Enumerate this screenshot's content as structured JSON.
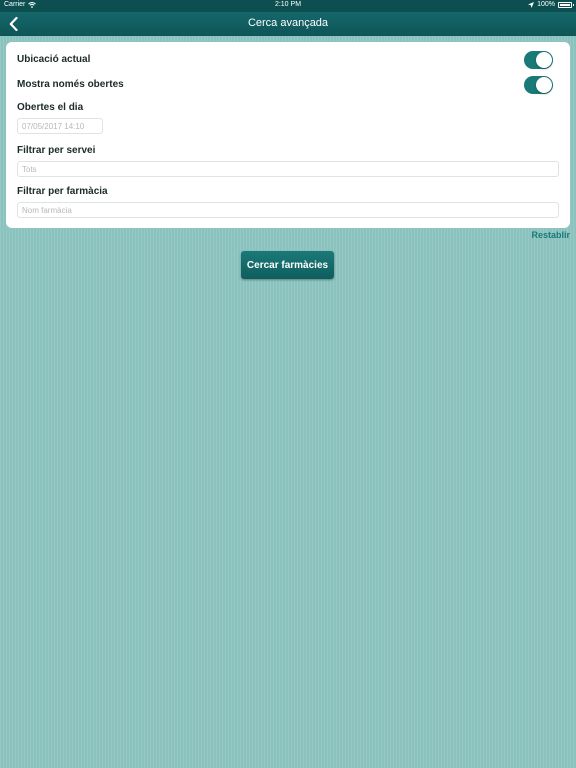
{
  "status_bar": {
    "carrier": "Carrier",
    "time": "2:10 PM",
    "battery": "100%",
    "icons": [
      "wifi-icon",
      "location-arrow-icon",
      "battery-icon"
    ]
  },
  "nav": {
    "title": "Cerca avançada",
    "back_icon": "chevron-left-icon"
  },
  "form": {
    "current_location_label": "Ubicació actual",
    "current_location_on": true,
    "only_open_label": "Mostra només obertes",
    "only_open_on": true,
    "open_on_day_label": "Obertes el dia",
    "open_on_day_value": "07/05/2017 14:10",
    "service_filter_label": "Filtrar per servei",
    "service_filter_placeholder": "Tots",
    "pharmacy_filter_label": "Filtrar per farmàcia",
    "pharmacy_filter_placeholder": "Nom farmàcia"
  },
  "actions": {
    "reset_label": "Restablir",
    "search_label": "Cercar farmàcies"
  },
  "colors": {
    "accent": "#1a7a78",
    "nav_background": "#0e5557",
    "page_background": "#8ec6c1"
  }
}
